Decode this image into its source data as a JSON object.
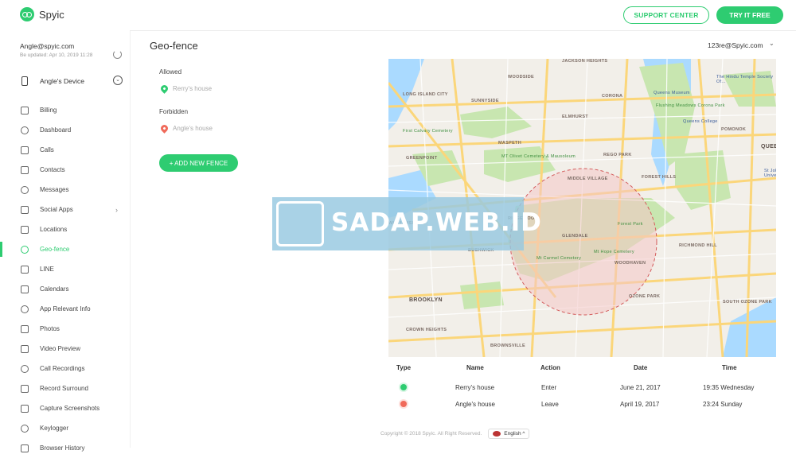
{
  "brand": {
    "name": "Spyic"
  },
  "topbar": {
    "support_label": "SUPPORT CENTER",
    "try_label": "TRY IT FREE"
  },
  "account": {
    "email": "Angle@spyic.com",
    "updated": "Be updated: Apr 10, 2019 11:28"
  },
  "device": {
    "name": "Angle's Device"
  },
  "sidebar": {
    "items": [
      {
        "label": "Billing",
        "icon": "billing-icon"
      },
      {
        "label": "Dashboard",
        "icon": "dashboard-icon"
      },
      {
        "label": "Calls",
        "icon": "phone-call-icon"
      },
      {
        "label": "Contacts",
        "icon": "contacts-icon"
      },
      {
        "label": "Messages",
        "icon": "messages-icon"
      },
      {
        "label": "Social Apps",
        "icon": "social-apps-icon",
        "arrow": "›"
      },
      {
        "label": "Locations",
        "icon": "location-icon"
      },
      {
        "label": "Geo-fence",
        "icon": "geo-fence-icon",
        "active": true
      },
      {
        "label": "LINE",
        "icon": "line-icon"
      },
      {
        "label": "Calendars",
        "icon": "calendar-icon"
      },
      {
        "label": "App Relevant Info",
        "icon": "apps-grid-icon"
      },
      {
        "label": "Photos",
        "icon": "photos-icon"
      },
      {
        "label": "Video Preview",
        "icon": "video-icon"
      },
      {
        "label": "Call Recordings",
        "icon": "microphone-icon"
      },
      {
        "label": "Record Surround",
        "icon": "record-surround-icon"
      },
      {
        "label": "Capture Screenshots",
        "icon": "screenshot-icon"
      },
      {
        "label": "Keylogger",
        "icon": "keyboard-icon"
      },
      {
        "label": "Browser History",
        "icon": "browser-history-icon"
      }
    ]
  },
  "main": {
    "title": "Geo-fence",
    "target_user": "123re@Spyic.com",
    "fences": {
      "allowed_heading": "Allowed",
      "allowed_item": "Rerry's house",
      "forbidden_heading": "Forbidden",
      "forbidden_item": "Angle's house",
      "add_label": "+ ADD NEW FENCE"
    },
    "map_labels": [
      "JACKSON HEIGHTS",
      "WOODSIDE",
      "LONG ISLAND CITY",
      "SUNNYSIDE",
      "CORONA",
      "The Hindu Temple Society Of...",
      "Queens Museum",
      "Flushing Meadows Corona Park",
      "Queens College",
      "POMONOK",
      "ELMHURST",
      "First Calvary Cemetery",
      "MASPETH",
      "REGO PARK",
      "GREENPOINT",
      "MT Olivet Cemetery & Mausoleum",
      "FOREST HILLS",
      "MIDDLE VILLAGE",
      "RIDGEWOOD",
      "GLENDALE",
      "Forest Park",
      "Mt Hope Cemetery",
      "Mt Carmel Cemetery",
      "WOODHAVEN",
      "RICHMOND HILL",
      "BUSHWICK",
      "WILLIAMSBURG",
      "BROOKLYN",
      "OZONE PARK",
      "SOUTH OZONE PARK",
      "CROWN HEIGHTS",
      "BROWNSVILLE",
      "QUEE",
      "St Johns University"
    ],
    "table": {
      "headers": [
        "Type",
        "Name",
        "Action",
        "Date",
        "Time"
      ],
      "rows": [
        {
          "type": "allowed",
          "name": "Rerry's house",
          "action": "Enter",
          "date": "June 21, 2017",
          "time": "19:35 Wednesday"
        },
        {
          "type": "forbidden",
          "name": "Angle's house",
          "action": "Leave",
          "date": "April 19, 2017",
          "time": "23:24 Sunday"
        }
      ]
    }
  },
  "footer": {
    "copyright": "Copyright © 2018 Spyic. All Right Reserved.",
    "language": "English ^"
  },
  "watermark": {
    "text": "SADAP.WEB.ID"
  },
  "colors": {
    "accent": "#2ecc71",
    "forbidden": "#f06a5a",
    "fence_circle": "#f4c6c6"
  }
}
